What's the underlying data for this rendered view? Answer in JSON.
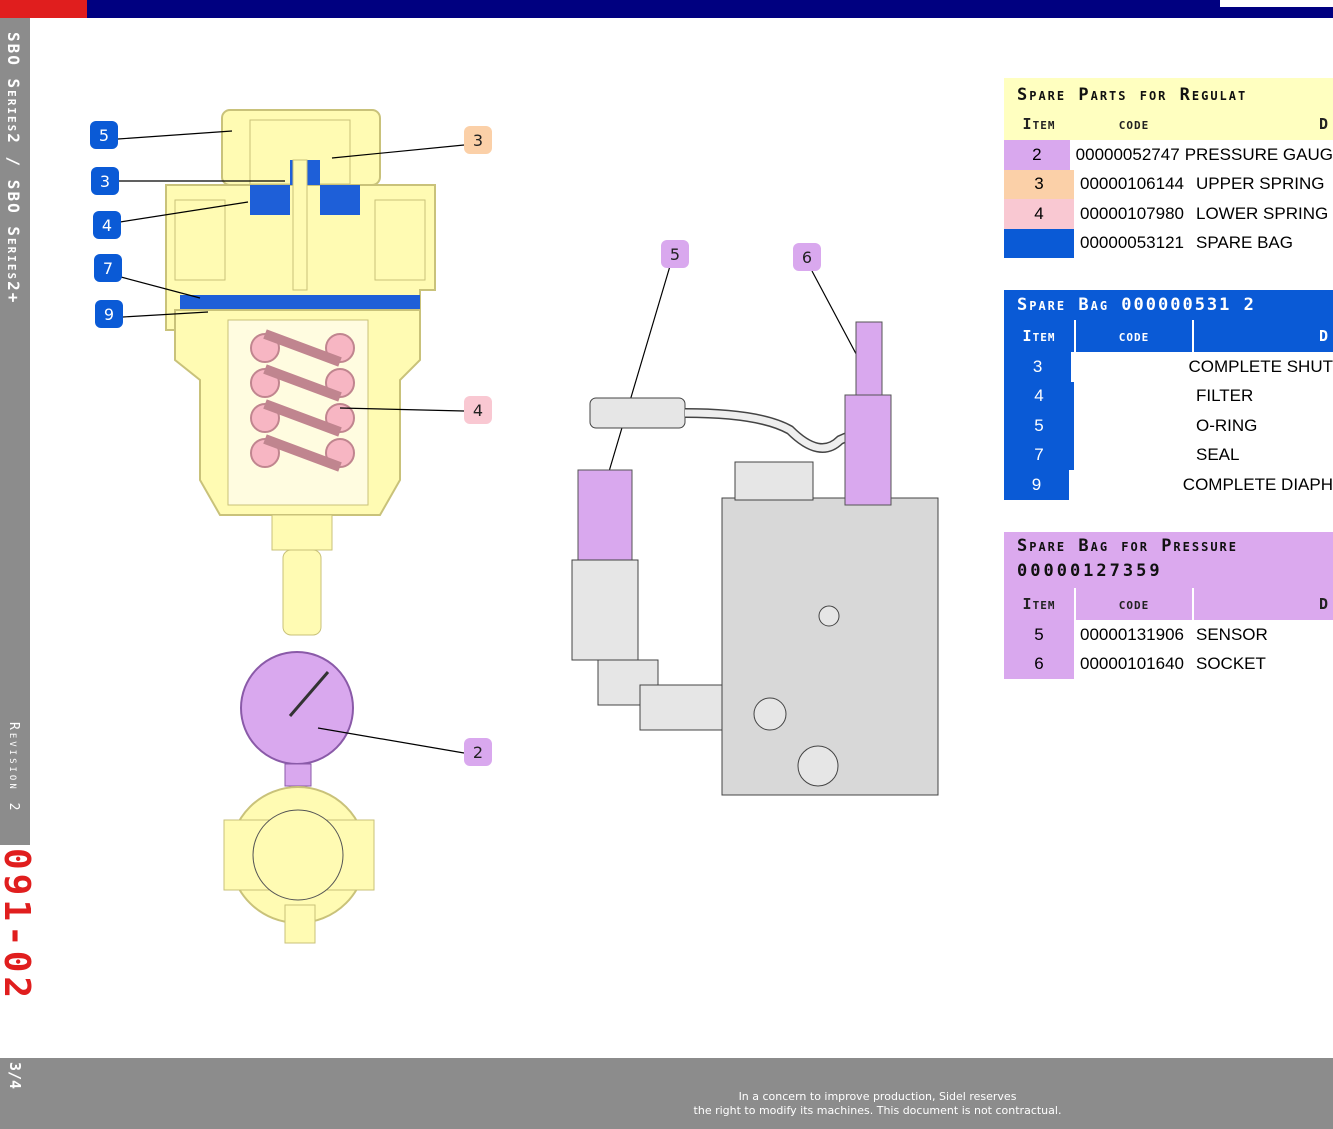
{
  "header": {
    "side_series": "SBO Series2 / SBO Series2+",
    "revision": "Revision 2",
    "doc_number": "091-02",
    "page": "3/4",
    "colors": {
      "red": "#e01e1e",
      "navy": "#000080",
      "gray": "#8c8c8c",
      "blue": "#0a5ad6",
      "orange": "#fbd0a8",
      "pink": "#f9c8d2",
      "violet": "#d9a8ee",
      "yellow": "#ffffc0"
    }
  },
  "callouts": {
    "left": [
      "5",
      "3",
      "4",
      "7",
      "9"
    ],
    "right_upper": "3",
    "right_spring": "4",
    "gauge": "2",
    "sensor": "5",
    "socket": "6"
  },
  "table_regulator": {
    "title": "Spare Parts for Regulat",
    "headers": {
      "item": "Item",
      "code": "code",
      "desc": "D"
    },
    "rows": [
      {
        "item": "2",
        "code": "00000052747",
        "desc": "PRESSURE GAUG",
        "color": "#d9a8ee"
      },
      {
        "item": "3",
        "code": "00000106144",
        "desc": "UPPER SPRING",
        "color": "#fbd0a8"
      },
      {
        "item": "4",
        "code": "00000107980",
        "desc": "LOWER SPRING",
        "color": "#f9c8d2"
      },
      {
        "item": "",
        "code": "00000053121",
        "desc": "SPARE BAG",
        "color": "#0a5ad6"
      }
    ]
  },
  "table_sparebag": {
    "title": "Spare Bag 000000531 2",
    "headers": {
      "item": "Item",
      "code": "code",
      "desc": "D"
    },
    "rows": [
      {
        "item": "3",
        "code": "",
        "desc": "COMPLETE SHUT"
      },
      {
        "item": "4",
        "code": "",
        "desc": "FILTER"
      },
      {
        "item": "5",
        "code": "",
        "desc": "O-RING"
      },
      {
        "item": "7",
        "code": "",
        "desc": "SEAL"
      },
      {
        "item": "9",
        "code": "",
        "desc": "COMPLETE DIAPH"
      }
    ]
  },
  "table_pressure": {
    "title": "Spare Bag for Pressure",
    "title_line2": "00000127359",
    "headers": {
      "item": "Item",
      "code": "code",
      "desc": "D"
    },
    "rows": [
      {
        "item": "5",
        "code": "00000131906",
        "desc": "SENSOR"
      },
      {
        "item": "6",
        "code": "00000101640",
        "desc": "SOCKET"
      }
    ]
  },
  "footer": {
    "line1": "In a concern to improve production, Sidel reserves",
    "line2": "the right to modify its machines. This document is not contractual."
  }
}
